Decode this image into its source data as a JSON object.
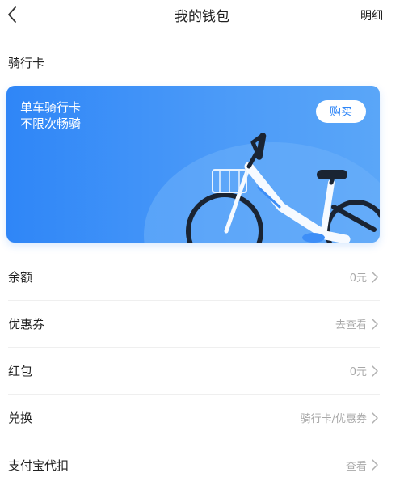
{
  "header": {
    "title": "我的钱包",
    "detail_label": "明细"
  },
  "section": {
    "title": "骑行卡"
  },
  "card": {
    "line1": "单车骑行卡",
    "line2": "不限次畅骑",
    "buy_label": "购买",
    "accent_color": "#2f86f7"
  },
  "rows": [
    {
      "label": "余额",
      "value": "0元"
    },
    {
      "label": "优惠券",
      "value": "去查看"
    },
    {
      "label": "红包",
      "value": "0元"
    },
    {
      "label": "兑换",
      "value": "骑行卡/优惠券"
    },
    {
      "label": "支付宝代扣",
      "value": "查看"
    }
  ]
}
